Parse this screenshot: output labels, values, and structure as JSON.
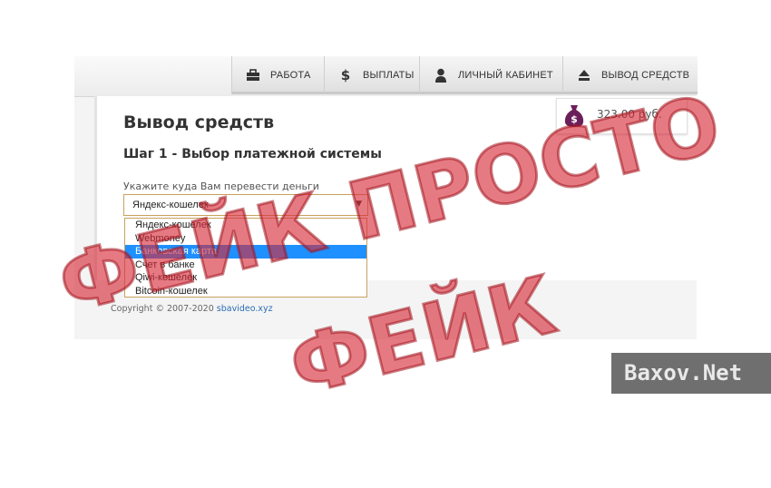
{
  "nav": [
    {
      "label": "РАБОТА",
      "icon": "briefcase-icon"
    },
    {
      "label": "ВЫПЛАТЫ",
      "icon": "dollar-icon"
    },
    {
      "label": "ЛИЧНЫЙ КАБИНЕТ",
      "icon": "user-icon"
    },
    {
      "label": "ВЫВОД СРЕДСТВ",
      "icon": "eject-icon"
    }
  ],
  "page": {
    "title": "Вывод средств",
    "step_title": "Шаг 1 - Выбор платежной системы",
    "select_hint": "Укажите куда Вам перевести деньги"
  },
  "select": {
    "value": "Яндекс-кошелек",
    "options": [
      "Яндекс-кошелек",
      "Webmoney",
      "Банковская карта",
      "Счет в банке",
      "Qiwi-кошелек",
      "Bitcoin-кошелек"
    ],
    "highlighted_index": 2
  },
  "balance": {
    "amount": "323.00 руб.",
    "icon": "money-bag-icon"
  },
  "footer": {
    "copyright": "Copyright © 2007-2020",
    "link": "sbavideo.xyz"
  },
  "stamp": {
    "text": "ФЕЙК ПРОСТО ФЕЙК"
  },
  "watermark": {
    "text": "Baxov.Net"
  },
  "colors": {
    "highlight": "#1e90ff",
    "stamp": "#d62837",
    "link": "#2a6db5"
  }
}
